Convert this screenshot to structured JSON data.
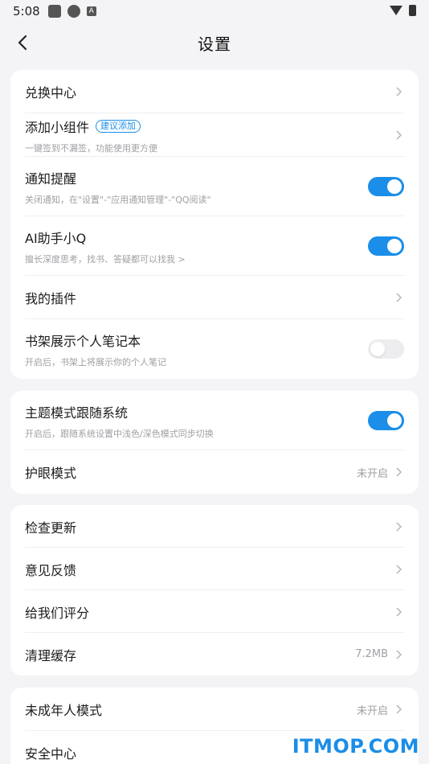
{
  "status_bar": {
    "time": "5:08",
    "icon_a_letter": "A"
  },
  "header": {
    "title": "设置"
  },
  "card1": {
    "redeem": {
      "title": "兑换中心"
    },
    "widget": {
      "title": "添加小组件",
      "badge": "建议添加",
      "subtitle": "一键签到不漏签，功能使用更方便"
    },
    "notify": {
      "title": "通知提醒",
      "subtitle": "关闭通知，在\"设置\"-\"应用通知管理\"-\"QQ阅读\"",
      "enabled": true
    },
    "ai": {
      "title": "AI助手小Q",
      "subtitle": "擅长深度思考，找书、答疑都可以找我 >",
      "enabled": true
    },
    "plugins": {
      "title": "我的插件"
    },
    "notes": {
      "title": "书架展示个人笔记本",
      "subtitle": "开启后，书架上将展示你的个人笔记",
      "enabled": false
    }
  },
  "card2": {
    "theme": {
      "title": "主题模式跟随系统",
      "subtitle": "开启后，跟随系统设置中浅色/深色模式同步切换",
      "enabled": true
    },
    "eye": {
      "title": "护眼模式",
      "value": "未开启"
    }
  },
  "card3": {
    "update": {
      "title": "检查更新"
    },
    "feedback": {
      "title": "意见反馈"
    },
    "rate": {
      "title": "给我们评分"
    },
    "cache": {
      "title": "清理缓存",
      "value": "7.2MB"
    }
  },
  "card4": {
    "minor": {
      "title": "未成年人模式",
      "value": "未开启"
    },
    "security": {
      "title": "安全中心"
    }
  },
  "watermark": "ITMOP.COM",
  "colors": {
    "accent": "#1a8ee8",
    "toggle_off": "#ededf0",
    "background": "#f4f4f6"
  }
}
